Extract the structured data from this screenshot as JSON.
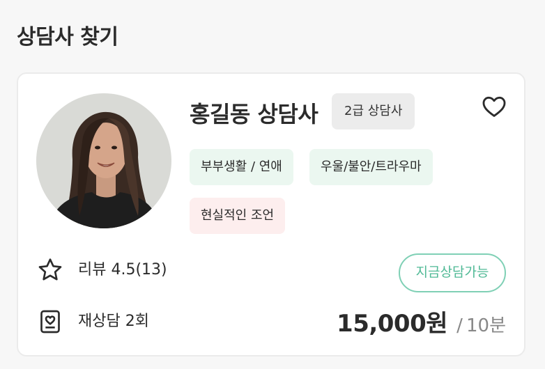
{
  "page": {
    "title": "상담사 찾기"
  },
  "counselor": {
    "name": "홍길동 상담사",
    "grade": "2급 상담사",
    "tags": [
      {
        "label": "부부생활 / 연애",
        "color": "#ebf7f0"
      },
      {
        "label": "우울/불안/트라우마",
        "color": "#ebf7f0"
      },
      {
        "label": "현실적인 조언",
        "color": "#fdeeee"
      }
    ],
    "review": "리뷰 4.5(13)",
    "recounsel": "재상담 2회",
    "status": "지금상담가능",
    "price": "15,000원",
    "price_separator": "/",
    "duration": "10분",
    "icons": {
      "favorite": "heart-outline-icon",
      "review": "star-outline-icon",
      "recounsel": "profile-card-icon"
    },
    "accent_color": "#7fd0b5"
  }
}
